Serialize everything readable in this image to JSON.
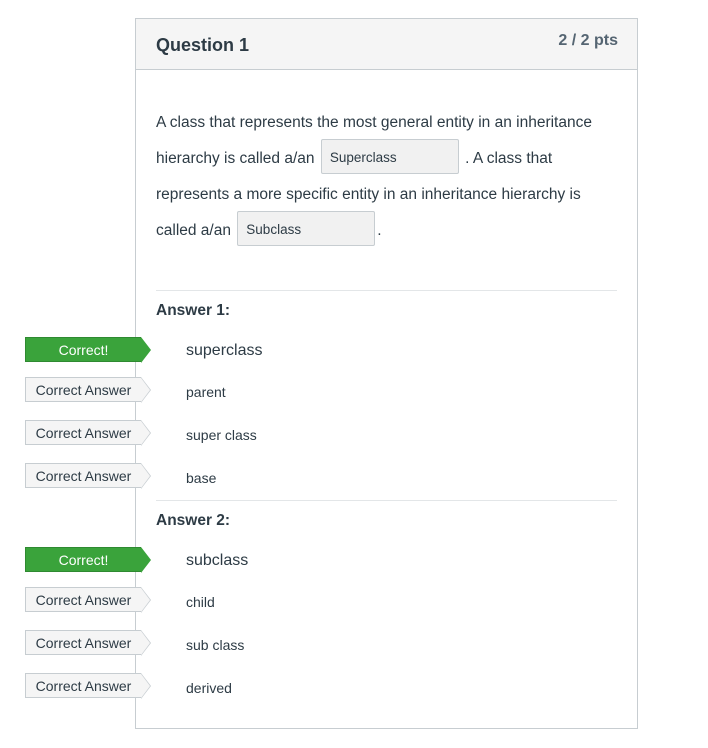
{
  "question": {
    "title": "Question 1",
    "points": "2 / 2 pts",
    "text_part1": "A class that represents the most general entity in an inheritance hierarchy is called a/an",
    "blank1_value": "Superclass",
    "text_part2": ". A class that represents a more specific entity in an inheritance hierarchy is called a/an",
    "blank2_value": "Subclass",
    "text_part3": "."
  },
  "answers": [
    {
      "label": "Answer 1:",
      "items": [
        {
          "tag": "Correct!",
          "text": "superclass",
          "kind": "correct"
        },
        {
          "tag": "Correct Answer",
          "text": "parent",
          "kind": "answer"
        },
        {
          "tag": "Correct Answer",
          "text": "super class",
          "kind": "answer"
        },
        {
          "tag": "Correct Answer",
          "text": "base",
          "kind": "answer"
        }
      ]
    },
    {
      "label": "Answer 2:",
      "items": [
        {
          "tag": "Correct!",
          "text": "subclass",
          "kind": "correct"
        },
        {
          "tag": "Correct Answer",
          "text": "child",
          "kind": "answer"
        },
        {
          "tag": "Correct Answer",
          "text": "sub class",
          "kind": "answer"
        },
        {
          "tag": "Correct Answer",
          "text": "derived",
          "kind": "answer"
        }
      ]
    }
  ],
  "colors": {
    "correct_green": "#3aa33b",
    "border_gray": "#c7cdd1",
    "text_dark": "#2d3b45"
  }
}
